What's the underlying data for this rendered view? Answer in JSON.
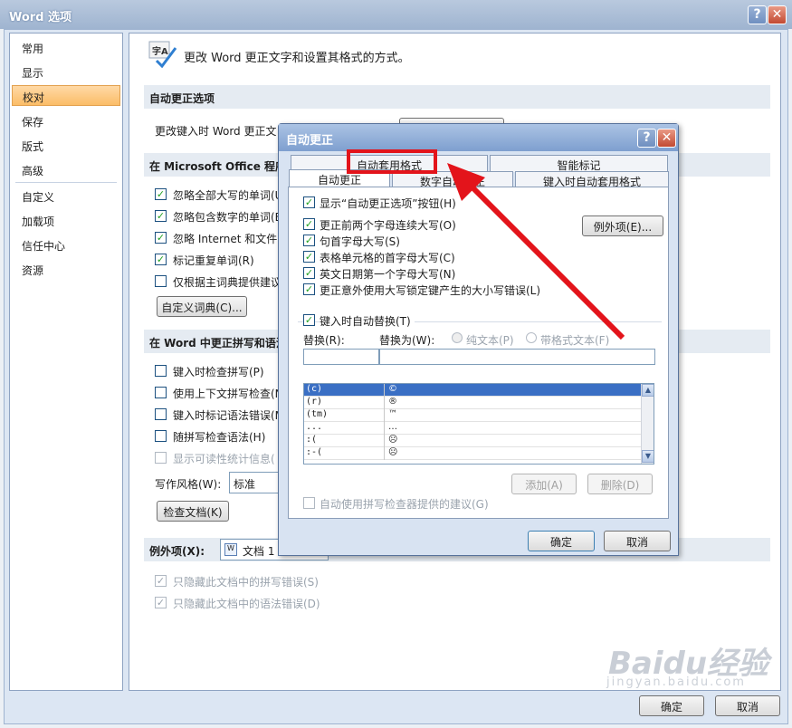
{
  "outer": {
    "title": "Word 选项",
    "help_glyph": "?",
    "close_glyph": "✕",
    "nav": [
      "常用",
      "显示",
      "校对",
      "保存",
      "版式",
      "高级",
      "自定义",
      "加载项",
      "信任中心",
      "资源"
    ],
    "header_text": "更改 Word 更正文字和设置其格式的方式。",
    "sec_autocorrect": "自动更正选项",
    "autocorrect_desc": "更改键入时 Word 更正文",
    "sec_office": "在 Microsoft Office 程序",
    "office_items": [
      "忽略全部大写的单词(U)",
      "忽略包含数字的单词(B)",
      "忽略 Internet 和文件",
      "标记重复单词(R)",
      "仅根据主词典提供建议"
    ],
    "custom_dict_btn": "自定义词典(C)...",
    "sec_word": "在 Word 中更正拼写和语法",
    "word_items": [
      "键入时检查拼写(P)",
      "使用上下文拼写检查(N",
      "键入时标记语法错误(M",
      "随拼写检查语法(H)",
      "显示可读性统计信息("
    ],
    "style_label": "写作风格(W):",
    "style_value": "标准",
    "check_doc_btn": "检查文档(K)",
    "sec_exceptions": "例外项(X):",
    "exceptions_doc": "文档 1",
    "exception_items": [
      "只隐藏此文档中的拼写错误(S)",
      "只隐藏此文档中的语法错误(D)"
    ],
    "ok": "确定",
    "cancel": "取消"
  },
  "dialog": {
    "title": "自动更正",
    "help_glyph": "?",
    "close_glyph": "✕",
    "tabs_top": [
      "自动套用格式",
      "智能标记"
    ],
    "tabs_bottom": [
      "自动更正",
      "数字自动更正",
      "键入时自动套用格式"
    ],
    "show_btn_option": "显示“自动更正选项”按钮(H)",
    "options": [
      "更正前两个字母连续大写(O)",
      "句首字母大写(S)",
      "表格单元格的首字母大写(C)",
      "英文日期第一个字母大写(N)",
      "更正意外使用大写锁定键产生的大小写错误(L)"
    ],
    "exceptions_btn": "例外项(E)...",
    "replace_as_you_type": "键入时自动替换(T)",
    "replace_label": "替换(R):",
    "with_label": "替换为(W):",
    "plain_text": "纯文本(P)",
    "formatted_text": "带格式文本(F)",
    "list": [
      {
        "from": "(c)",
        "to": "©"
      },
      {
        "from": "(r)",
        "to": "®"
      },
      {
        "from": "(tm)",
        "to": "™"
      },
      {
        "from": "...",
        "to": "…"
      },
      {
        "from": ":(",
        "to": "☹"
      },
      {
        "from": ":-(",
        "to": "☹"
      }
    ],
    "add_btn": "添加(A)",
    "delete_btn": "删除(D)",
    "spell_suggest": "自动使用拼写检查器提供的建议(G)",
    "ok": "确定",
    "cancel": "取消"
  },
  "watermark": {
    "brand": "Baidu经验",
    "url": "jingyan.baidu.com"
  },
  "colors": {
    "annotation_red": "#e3141b",
    "nav_selected": "#fbbd67"
  }
}
